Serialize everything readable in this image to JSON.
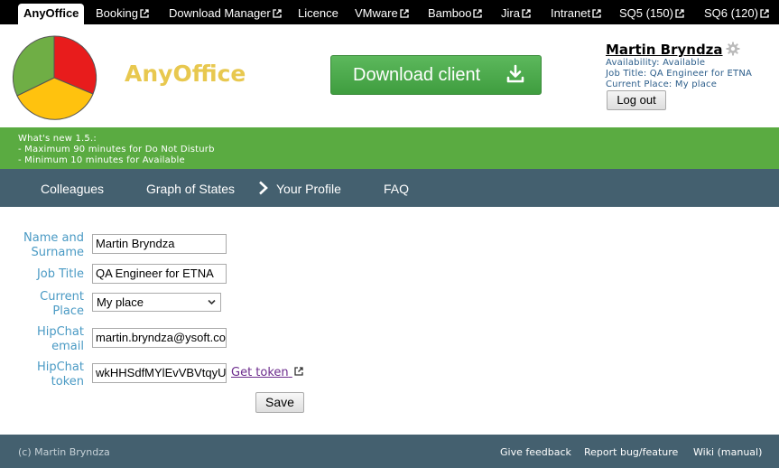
{
  "topbar": {
    "tabs": [
      {
        "label": "AnyOffice",
        "active": true,
        "external": false
      },
      {
        "label": "Booking",
        "external": true
      },
      {
        "label": "Download Manager",
        "external": true
      },
      {
        "label": "Licence",
        "external": false
      },
      {
        "label": "VMware",
        "external": true
      },
      {
        "label": "Bamboo",
        "external": true
      },
      {
        "label": "Jira",
        "external": true
      },
      {
        "label": "Intranet",
        "external": true
      },
      {
        "label": "SQ5 (150)",
        "external": true
      },
      {
        "label": "SQ6 (120)",
        "external": true
      }
    ]
  },
  "header": {
    "brand": "AnyOffice",
    "download_label": "Download client",
    "logo_colors": {
      "red": "#e81c1c",
      "yellow": "#ffc20e",
      "green": "#6fae45"
    },
    "user": {
      "name": "Martin Bryndza",
      "availability": "Availability: Available",
      "job_title": "Job Title: QA Engineer for ETNA",
      "current_place": "Current Place: My place",
      "logout_label": "Log out"
    }
  },
  "news": {
    "title": "What's new 1.5.:",
    "lines": [
      "- Maximum 90 minutes for Do Not Disturb",
      "- Minimum 10 minutes for Available"
    ]
  },
  "nav": {
    "items": [
      "Colleagues",
      "Graph of States",
      "Your Profile",
      "FAQ"
    ],
    "active_index": 2
  },
  "form": {
    "name_label_1": "Name and",
    "name_label_2": "Surname",
    "name_value": "Martin Bryndza",
    "job_label": "Job Title",
    "job_value": "QA Engineer for ETNA",
    "place_label_1": "Current",
    "place_label_2": "Place",
    "place_value": "My place",
    "email_label_1": "HipChat",
    "email_label_2": "email",
    "email_value": "martin.bryndza@ysoft.com",
    "token_label_1": "HipChat",
    "token_label_2": "token",
    "token_value": "wkHHSdfMYlEvVBVtqyUw",
    "get_token_label": "Get token",
    "save_label": "Save"
  },
  "footer": {
    "copyright": "(c) Martin Bryndza",
    "links": [
      "Give feedback",
      "Report bug/feature",
      "Wiki (manual)"
    ]
  },
  "colors": {
    "nav_bg": "#44606f",
    "news_bg": "#5aab41",
    "download_green": "#4cad4c",
    "brand_yellow": "#e8c84f",
    "label_blue": "#4a9ac4"
  }
}
